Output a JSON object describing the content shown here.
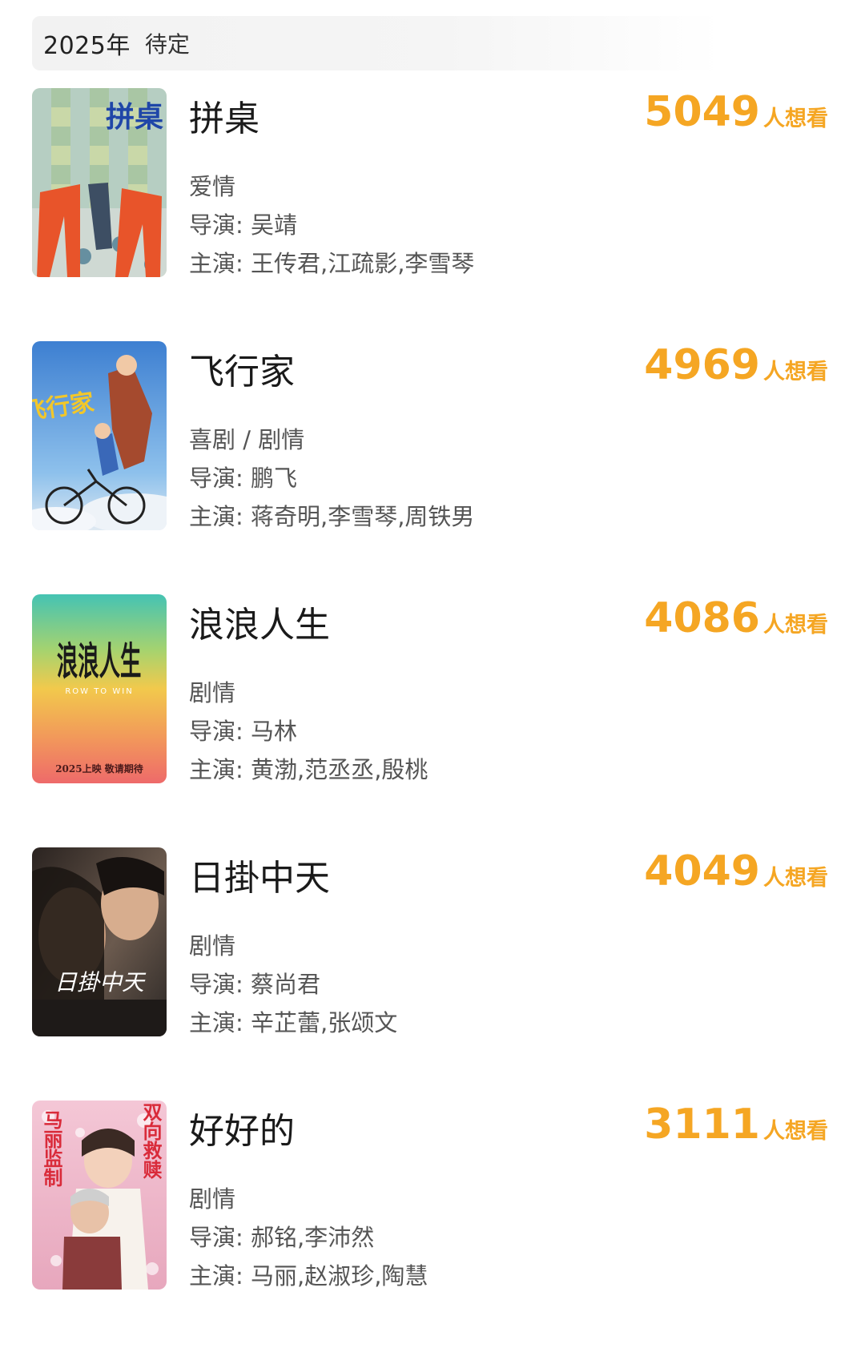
{
  "header": {
    "year": "2025年",
    "status": "待定"
  },
  "movies": [
    {
      "title": "拼桌",
      "want_count": "5049",
      "want_suffix": "人想看",
      "genre": "爱情",
      "director": "导演: 吴靖",
      "cast": "主演: 王传君,江疏影,李雪琴",
      "poster_text": "拼桌"
    },
    {
      "title": "飞行家",
      "want_count": "4969",
      "want_suffix": "人想看",
      "genre": "喜剧 / 剧情",
      "director": "导演: 鹏飞",
      "cast": "主演: 蒋奇明,李雪琴,周铁男",
      "poster_text": "飞行家"
    },
    {
      "title": "浪浪人生",
      "want_count": "4086",
      "want_suffix": "人想看",
      "genre": "剧情",
      "director": "导演: 马林",
      "cast": "主演: 黄渤,范丞丞,殷桃",
      "poster_text": "浪浪人生",
      "poster_subtext": "ROW TO WIN",
      "poster_footer": "2025上映 敬请期待"
    },
    {
      "title": "日掛中天",
      "want_count": "4049",
      "want_suffix": "人想看",
      "genre": "剧情",
      "director": "导演: 蔡尚君",
      "cast": "主演: 辛芷蕾,张颂文",
      "poster_text": "日掛中天"
    },
    {
      "title": "好好的",
      "want_count": "3111",
      "want_suffix": "人想看",
      "genre": "剧情",
      "director": "导演: 郝铭,李沛然",
      "cast": "主演: 马丽,赵淑珍,陶慧",
      "poster_text_left": "马丽监制",
      "poster_text_right": "双向救赎"
    }
  ],
  "colors": {
    "want_accent": "#f5a623",
    "header_bg": "#f3f3f3"
  }
}
